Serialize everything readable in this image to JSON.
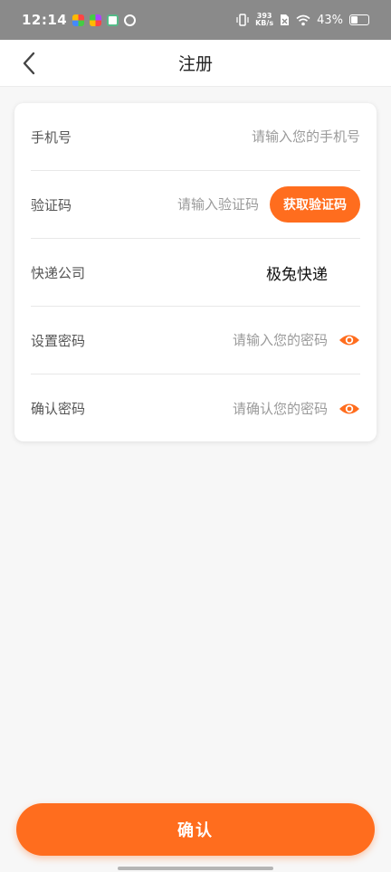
{
  "status_bar": {
    "time": "12:14",
    "net_speed_value": "393",
    "net_speed_unit": "KB/s",
    "battery_percent": "43%",
    "battery_level": 0.43
  },
  "nav": {
    "title": "注册"
  },
  "form": {
    "phone": {
      "label": "手机号",
      "placeholder": "请输入您的手机号"
    },
    "code": {
      "label": "验证码",
      "placeholder": "请输入验证码",
      "button": "获取验证码"
    },
    "courier": {
      "label": "快递公司",
      "value": "极兔快递"
    },
    "password": {
      "label": "设置密码",
      "placeholder": "请输入您的密码"
    },
    "confirm_password": {
      "label": "确认密码",
      "placeholder": "请确认您的密码"
    }
  },
  "submit": {
    "label": "确认"
  },
  "colors": {
    "accent": "#ff6d1e",
    "status_bar_bg": "#8a8a8a",
    "page_bg": "#f7f7f7"
  },
  "icons": {
    "back": "chevron-left-icon",
    "password_toggle": "eye-icon"
  }
}
